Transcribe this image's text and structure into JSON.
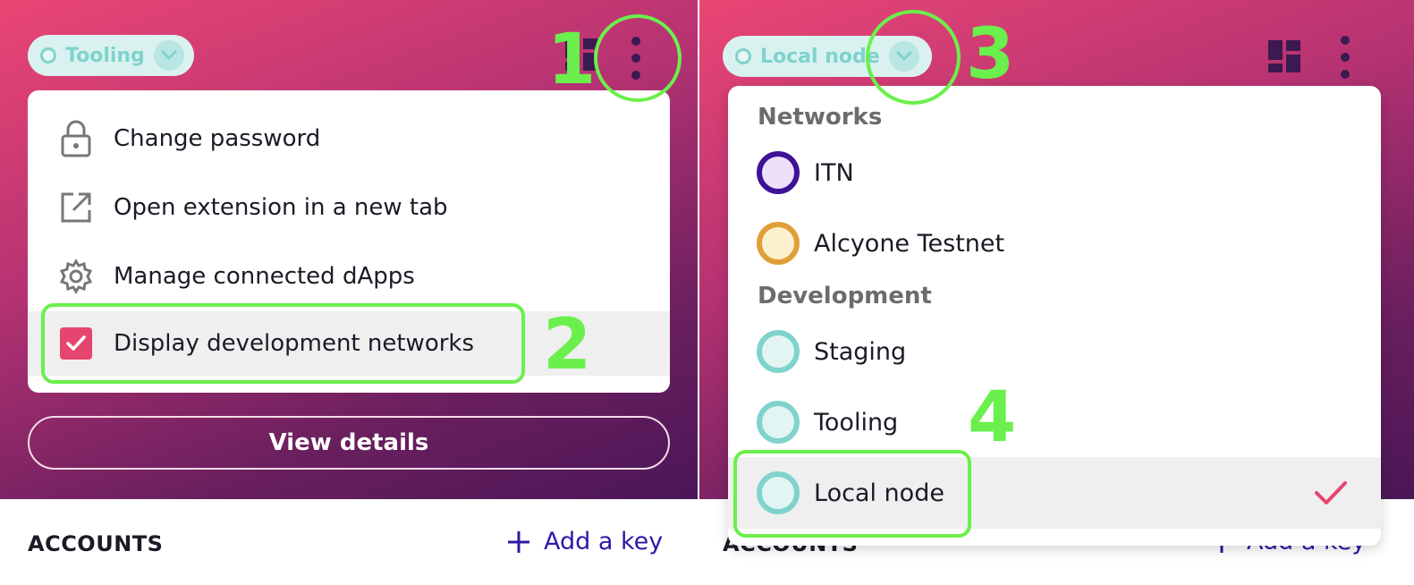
{
  "left_panel": {
    "network_selector": {
      "label": "Tooling",
      "dot_color": "#7fd3cc"
    },
    "menu": {
      "items": [
        {
          "label": "Change password",
          "icon": "lock-icon"
        },
        {
          "label": "Open extension in a new tab",
          "icon": "external-link-icon"
        },
        {
          "label": "Manage connected dApps",
          "icon": "gear-icon"
        },
        {
          "label": "Display development networks",
          "icon": "checkbox-checked-icon",
          "checked": true
        }
      ]
    },
    "view_details_label": "View details",
    "accounts_label": "ACCOUNTS",
    "add_key_label": "Add a key"
  },
  "right_panel": {
    "network_selector": {
      "label": "Local node",
      "dot_color": "#7fd3cc"
    },
    "sections": [
      {
        "title": "Networks",
        "items": [
          {
            "label": "ITN",
            "border": "#3e1196",
            "fill": "#ece0fb"
          },
          {
            "label": "Alcyone Testnet",
            "border": "#e0a037",
            "fill": "#fcf1cf"
          }
        ]
      },
      {
        "title": "Development",
        "items": [
          {
            "label": "Staging",
            "border": "#7fd3cc",
            "fill": "#e3f5f3"
          },
          {
            "label": "Tooling",
            "border": "#7fd3cc",
            "fill": "#e3f5f3"
          },
          {
            "label": "Local node",
            "border": "#7fd3cc",
            "fill": "#e3f5f3",
            "selected": true
          }
        ]
      }
    ],
    "accounts_label": "ACCOUNTS",
    "add_key_label": "Add a key"
  },
  "annotations": {
    "step1": "1",
    "step2": "2",
    "step3": "3",
    "step4": "4"
  },
  "colors": {
    "accent_pink": "#e6456f",
    "annotation_green": "#6bef4c",
    "link_blue": "#2c1aa5"
  }
}
